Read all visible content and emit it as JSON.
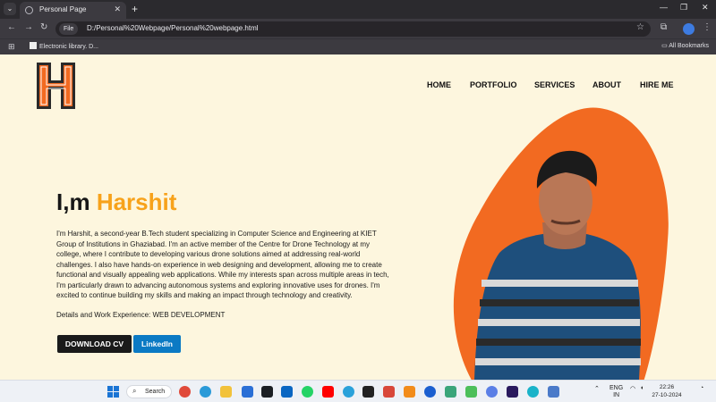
{
  "browser": {
    "tab_title": "Personal Page",
    "url": "D:/Personal%20Webpage/Personal%20webpage.html",
    "file_chip": "File",
    "bookmark_item": "Electronic library. D...",
    "all_bookmarks": "All Bookmarks"
  },
  "site": {
    "logo_letter": "H",
    "nav": [
      "HOME",
      "PORTFOLIO",
      "SERVICES",
      "ABOUT",
      "HIRE ME"
    ],
    "hero": {
      "greeting": "I,m",
      "name": "Harshit",
      "bio": "I'm Harshit, a second-year B.Tech student specializing in Computer Science and Engineering at KIET Group of Institutions in Ghaziabad. I'm an active member of the Centre for Drone Technology at my college, where I contribute to developing various drone solutions aimed at addressing real-world challenges. I also have hands-on experience in web designing and development, allowing me to create functional and visually appealing web applications. While my interests span across multiple areas in tech, I'm particularly drawn to advancing autonomous systems and exploring innovative uses for drones. I'm excited to continue building my skills and making an impact through technology and creativity.",
      "experience": "Details and Work Experience: WEB DEVELOPMENT",
      "download_label": "DOWNLOAD CV",
      "linkedin_label": "LinkedIn"
    },
    "colors": {
      "accent": "#f7a21b",
      "blob": "#f26a21",
      "background": "#fdf6de",
      "linkedin": "#0b7ac4"
    }
  },
  "taskbar": {
    "search_label": "Search",
    "lang_line1": "ENG",
    "lang_line2": "IN",
    "time": "22:26",
    "date": "27-10-2024"
  }
}
